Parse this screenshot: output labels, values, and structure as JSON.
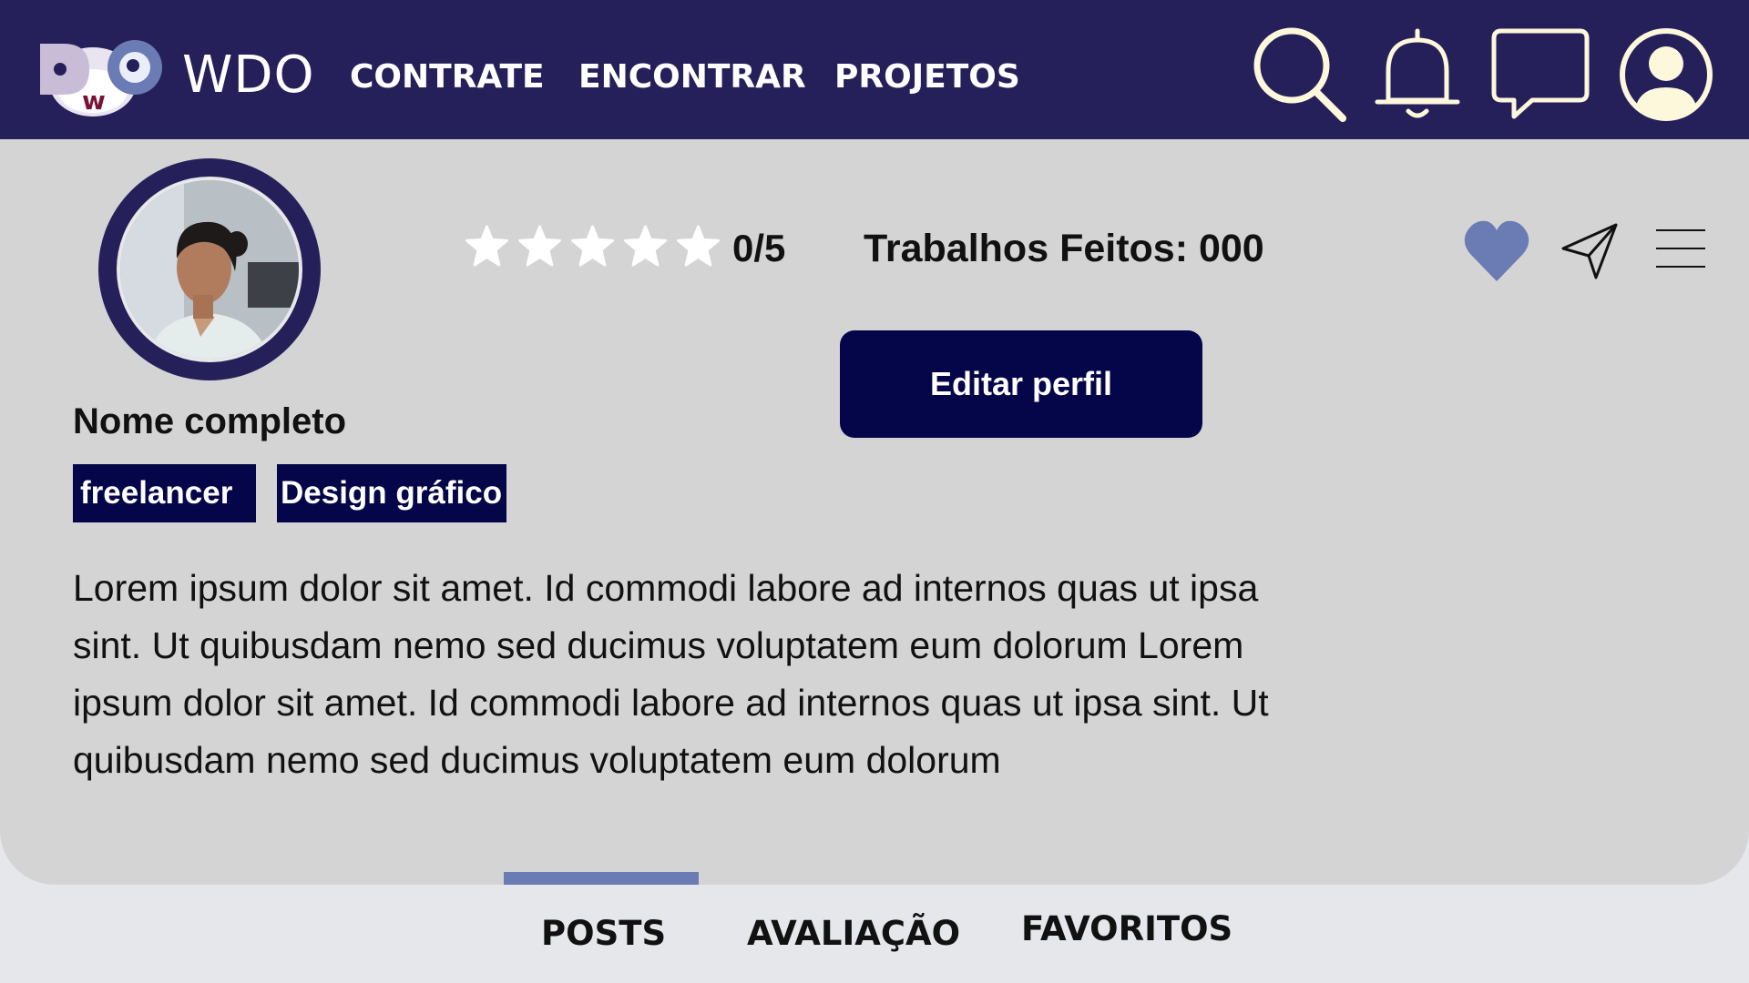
{
  "navbar": {
    "brand": "WDO",
    "logo_letters": [
      "D",
      "w",
      "O"
    ],
    "links": [
      "CONTRATE",
      "ENCONTRAR",
      "PROJETOS"
    ],
    "icons": [
      "search-icon",
      "bell-icon",
      "chat-icon",
      "user-icon"
    ]
  },
  "profile": {
    "name": "Nome completo",
    "tags": [
      "freelancer",
      "Design gráfico"
    ],
    "rating": {
      "value": 0,
      "max": 5,
      "text": "0/5"
    },
    "jobs_text": "Trabalhos Feitos: 000",
    "edit_button": "Editar perfil",
    "actions": [
      "heart-icon",
      "send-icon",
      "menu-icon"
    ],
    "bio": "Lorem ipsum dolor sit amet. Id commodi labore ad internos quas ut ipsa sint. Ut quibusdam nemo sed ducimus voluptatem eum dolorum Lorem ipsum dolor sit amet. Id commodi labore ad internos quas ut ipsa sint. Ut quibusdam nemo sed ducimus voluptatem eum dolorum"
  },
  "tabs": {
    "items": [
      "POSTS",
      "AVALIAÇÃO",
      "FAVORITOS"
    ],
    "active": "POSTS"
  },
  "colors": {
    "navbar_bg": "#26205a",
    "primary_dark": "#050549",
    "accent": "#6b7bb3",
    "card_bg": "#d4d4d5",
    "page_bg": "#e6e7eb",
    "icon_cream": "#fdf8dc",
    "heart": "#6b7bb3"
  }
}
